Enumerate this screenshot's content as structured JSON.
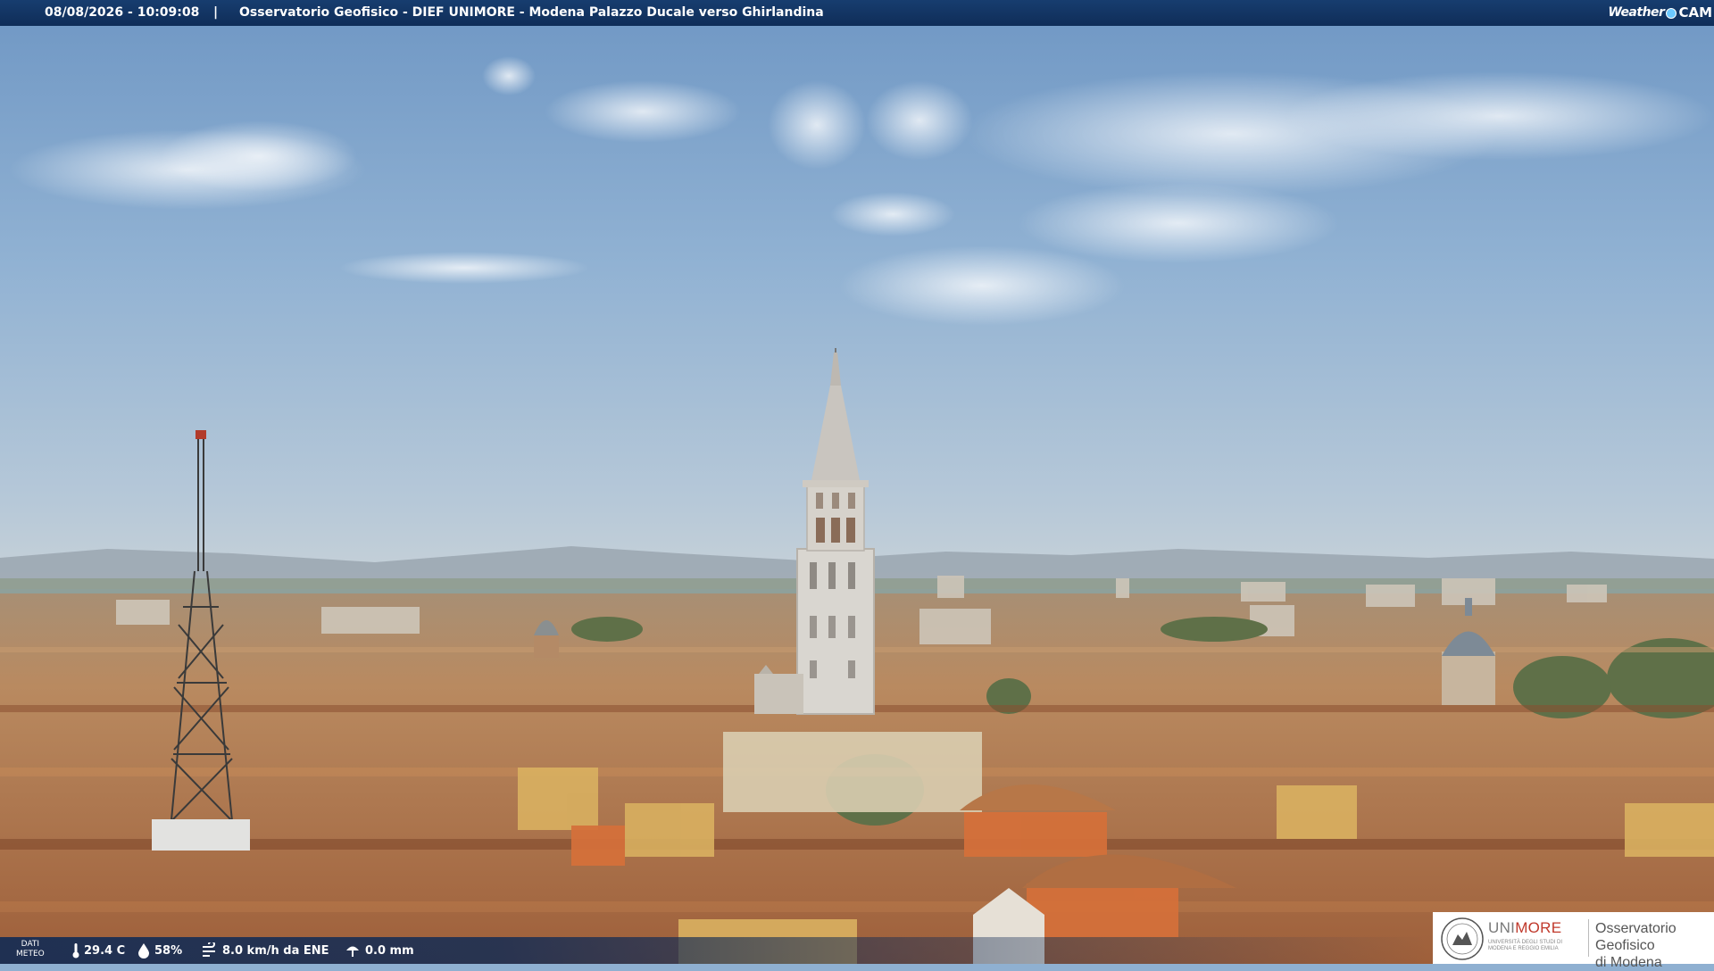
{
  "header": {
    "datetime": "08/08/2026 - 10:09:08",
    "separator": "|",
    "title": "Osservatorio Geofisico - DIEF UNIMORE - Modena Palazzo Ducale verso Ghirlandina",
    "brand_prefix": "Weather",
    "brand_suffix": "CAM"
  },
  "weather": {
    "label_line1": "DATI",
    "label_line2": "METEO",
    "temperature": "29.4 C",
    "humidity": "58%",
    "wind": "8.0 km/h da ENE",
    "rain": "0.0 mm",
    "icons": [
      "thermometer-icon",
      "humidity-drop-icon",
      "wind-icon",
      "rain-gauge-icon"
    ]
  },
  "logo": {
    "uni_prefix": "UNI",
    "uni_suffix": "MORE",
    "uni_subtitle_1": "UNIVERSITÀ DEGLI STUDI DI",
    "uni_subtitle_2": "MODENA E REGGIO EMILIA",
    "observatory_line1": "Osservatorio Geofisico",
    "observatory_line2": "di Modena"
  },
  "colors": {
    "header_bg": "#173d6f",
    "sky": "#8fb0d1",
    "roofs": "#b5764a",
    "unimore_red": "#c0392b"
  }
}
